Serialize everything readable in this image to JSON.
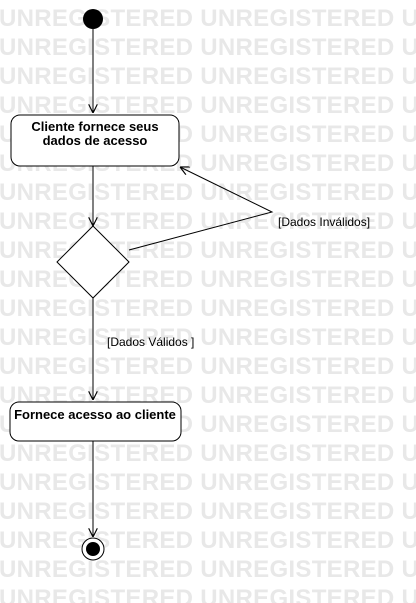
{
  "watermark": {
    "text": "UNREGISTERED UNREGISTERED UNREGISTERED U"
  },
  "diagram": {
    "type": "uml-activity",
    "nodes": {
      "start": {
        "kind": "initial"
      },
      "action1": {
        "kind": "action",
        "lines": [
          "Cliente fornece seus",
          "dados de acesso"
        ]
      },
      "decision": {
        "kind": "decision"
      },
      "action2": {
        "kind": "action",
        "lines": [
          "Fornece acesso ao cliente"
        ]
      },
      "end": {
        "kind": "final"
      }
    },
    "guards": {
      "invalid": "[Dados Inválidos]",
      "valid": "[Dados Válidos ]"
    },
    "edges": [
      {
        "from": "start",
        "to": "action1"
      },
      {
        "from": "action1",
        "to": "decision"
      },
      {
        "from": "decision",
        "to": "action1",
        "guard": "invalid"
      },
      {
        "from": "decision",
        "to": "action2",
        "guard": "valid"
      },
      {
        "from": "action2",
        "to": "end"
      }
    ]
  }
}
